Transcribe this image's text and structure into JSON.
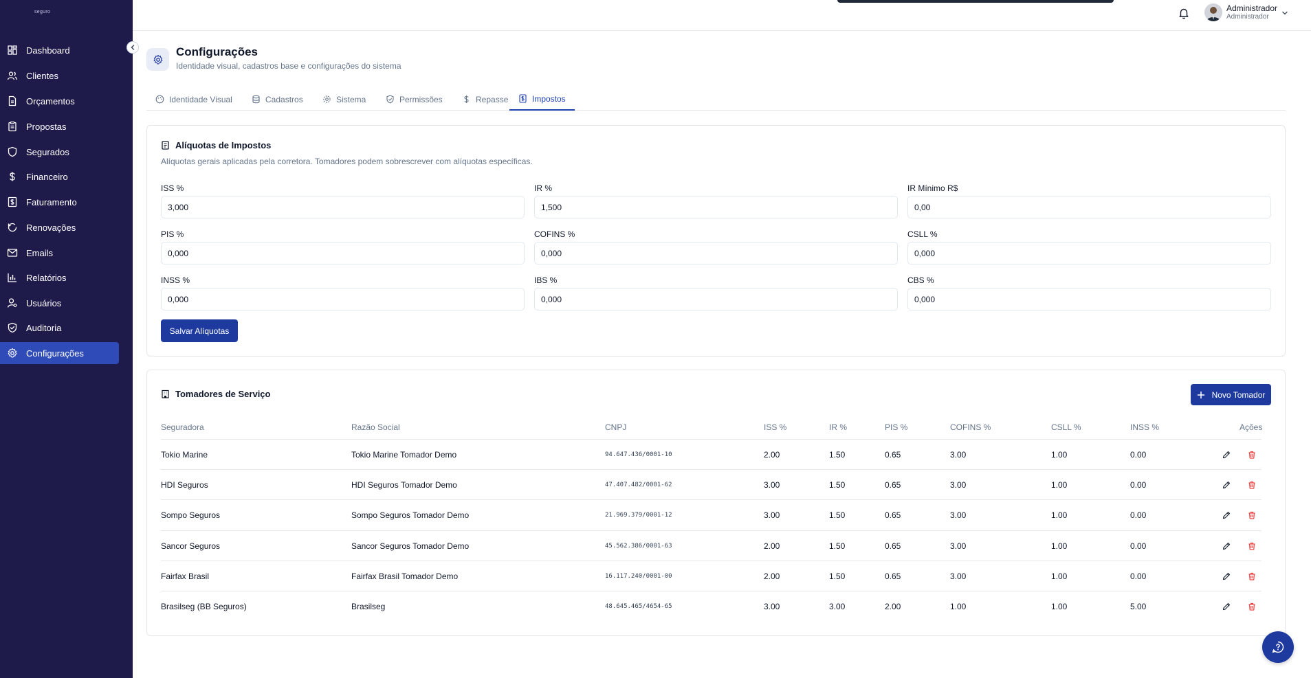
{
  "sidebar": {
    "brand": "seguro",
    "items": [
      {
        "label": "Dashboard",
        "icon": "dashboard-icon"
      },
      {
        "label": "Clientes",
        "icon": "users-icon"
      },
      {
        "label": "Orçamentos",
        "icon": "file-icon"
      },
      {
        "label": "Propostas",
        "icon": "clipboard-icon"
      },
      {
        "label": "Segurados",
        "icon": "shield-icon"
      },
      {
        "label": "Financeiro",
        "icon": "dollar-icon"
      },
      {
        "label": "Faturamento",
        "icon": "receipt-icon"
      },
      {
        "label": "Renovações",
        "icon": "refresh-icon"
      },
      {
        "label": "Emails",
        "icon": "mail-icon"
      },
      {
        "label": "Relatórios",
        "icon": "bar-chart-icon"
      },
      {
        "label": "Usuários",
        "icon": "user-key-icon"
      },
      {
        "label": "Auditoria",
        "icon": "shield-check-icon"
      },
      {
        "label": "Configurações",
        "icon": "gear-icon",
        "active": true
      }
    ]
  },
  "topbar": {
    "user_name": "Administrador",
    "user_role": "Administrador"
  },
  "header": {
    "title": "Configurações",
    "subtitle": "Identidade visual, cadastros base e configurações do sistema"
  },
  "tabs": [
    {
      "label": "Identidade Visual"
    },
    {
      "label": "Cadastros"
    },
    {
      "label": "Sistema"
    },
    {
      "label": "Permissões"
    },
    {
      "label": "Repasse"
    },
    {
      "label": "Impostos",
      "active": true
    }
  ],
  "taxes": {
    "title": "Alíquotas de Impostos",
    "description": "Alíquotas gerais aplicadas pela corretora. Tomadores podem sobrescrever com alíquotas específicas.",
    "fields": [
      {
        "label": "ISS %",
        "value": "3,000"
      },
      {
        "label": "IR %",
        "value": "1,500"
      },
      {
        "label": "IR Mínimo R$",
        "value": "0,00"
      },
      {
        "label": "PIS %",
        "value": "0,000"
      },
      {
        "label": "COFINS %",
        "value": "0,000"
      },
      {
        "label": "CSLL %",
        "value": "0,000"
      },
      {
        "label": "INSS %",
        "value": "0,000"
      },
      {
        "label": "IBS %",
        "value": "0,000"
      },
      {
        "label": "CBS %",
        "value": "0,000"
      }
    ],
    "save_label": "Salvar Alíquotas"
  },
  "tomadores": {
    "title": "Tomadores de Serviço",
    "new_label": "Novo Tomador",
    "columns": [
      "Seguradora",
      "Razão Social",
      "CNPJ",
      "ISS %",
      "IR %",
      "PIS %",
      "COFINS %",
      "CSLL %",
      "INSS %",
      "Ações"
    ],
    "rows": [
      [
        "Tokio Marine",
        "Tokio Marine Tomador Demo",
        "94.647.436/0001-10",
        "2.00",
        "1.50",
        "0.65",
        "3.00",
        "1.00",
        "0.00"
      ],
      [
        "HDI Seguros",
        "HDI Seguros Tomador Demo",
        "47.407.482/0001-62",
        "3.00",
        "1.50",
        "0.65",
        "3.00",
        "1.00",
        "0.00"
      ],
      [
        "Sompo Seguros",
        "Sompo Seguros Tomador Demo",
        "21.969.379/0001-12",
        "3.00",
        "1.50",
        "0.65",
        "3.00",
        "1.00",
        "0.00"
      ],
      [
        "Sancor Seguros",
        "Sancor Seguros Tomador Demo",
        "45.562.386/0001-63",
        "2.00",
        "1.50",
        "0.65",
        "3.00",
        "1.00",
        "0.00"
      ],
      [
        "Fairfax Brasil",
        "Fairfax Brasil Tomador Demo",
        "16.117.240/0001-00",
        "2.00",
        "1.50",
        "0.65",
        "3.00",
        "1.00",
        "0.00"
      ],
      [
        "Brasilseg (BB Seguros)",
        "Brasilseg",
        "48.645.465/4654-65",
        "3.00",
        "3.00",
        "2.00",
        "1.00",
        "1.00",
        "5.00"
      ]
    ]
  },
  "colors": {
    "sidebar_bg": "#1e1b4b",
    "active_nav": "#2f4bb8",
    "primary": "#1e3a9e",
    "danger": "#ef4444"
  }
}
